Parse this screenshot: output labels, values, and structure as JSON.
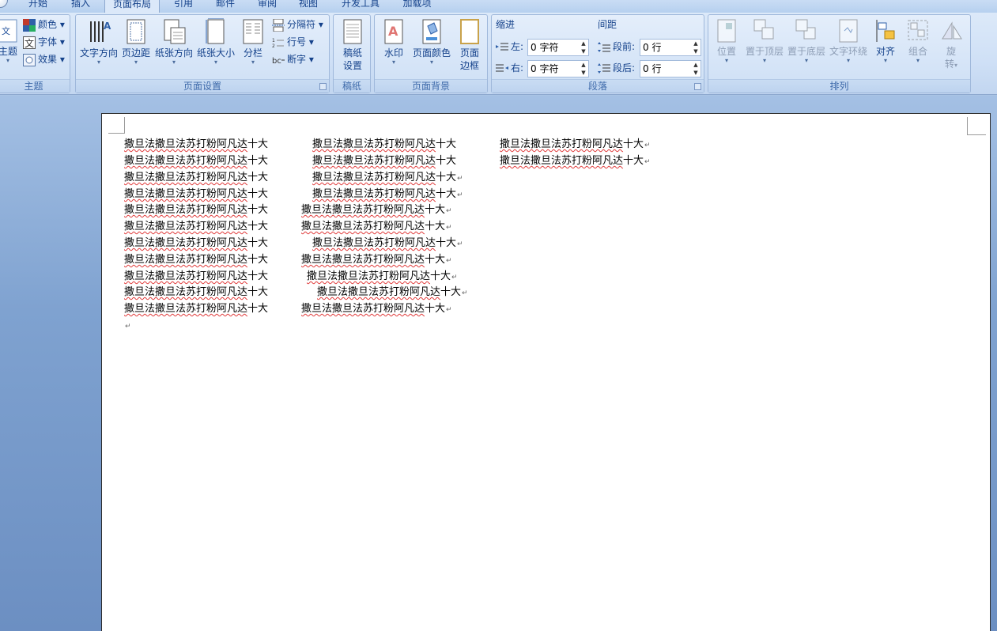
{
  "tabs": [
    "开始",
    "插入",
    "页面布局",
    "引用",
    "邮件",
    "审阅",
    "视图",
    "开发工具",
    "加载项"
  ],
  "groups": {
    "theme": {
      "label": "主题",
      "theme_button": "主题",
      "colors": "颜色",
      "fonts": "字体",
      "effects": "效果"
    },
    "page_setup": {
      "label": "页面设置",
      "text_direction": "文字方向",
      "margins": "页边距",
      "orientation": "纸张方向",
      "size": "纸张大小",
      "columns": "分栏",
      "breaks": "分隔符",
      "line_numbers": "行号",
      "hyphenation": "断字"
    },
    "manuscript": {
      "label": "稿纸",
      "settings_line1": "稿纸",
      "settings_line2": "设置"
    },
    "page_background": {
      "label": "页面背景",
      "watermark": "水印",
      "page_color": "页面颜色",
      "borders_line1": "页面",
      "borders_line2": "边框"
    },
    "paragraph": {
      "label": "段落",
      "indent_title": "缩进",
      "left_label": "左:",
      "left_value": "0 字符",
      "right_label": "右:",
      "right_value": "0 字符",
      "spacing_title": "间距",
      "before_label": "段前:",
      "before_value": "0 行",
      "after_label": "段后:",
      "after_value": "0 行"
    },
    "arrange": {
      "label": "排列",
      "position": "位置",
      "bring_front": "置于顶层",
      "send_back": "置于底层",
      "text_wrap": "文字环绕",
      "align": "对齐",
      "group": "组合",
      "rotate_line1": "旋",
      "rotate_line2": "转"
    }
  },
  "document": {
    "text_body": "撒旦法撒旦法苏打粉阿凡达",
    "text_tail": "十大",
    "paragraph_mark": "↵"
  },
  "colors": {
    "accent": "#15428b",
    "ribbon": "#dce9f9",
    "spell_underline": "#e03a3a"
  }
}
